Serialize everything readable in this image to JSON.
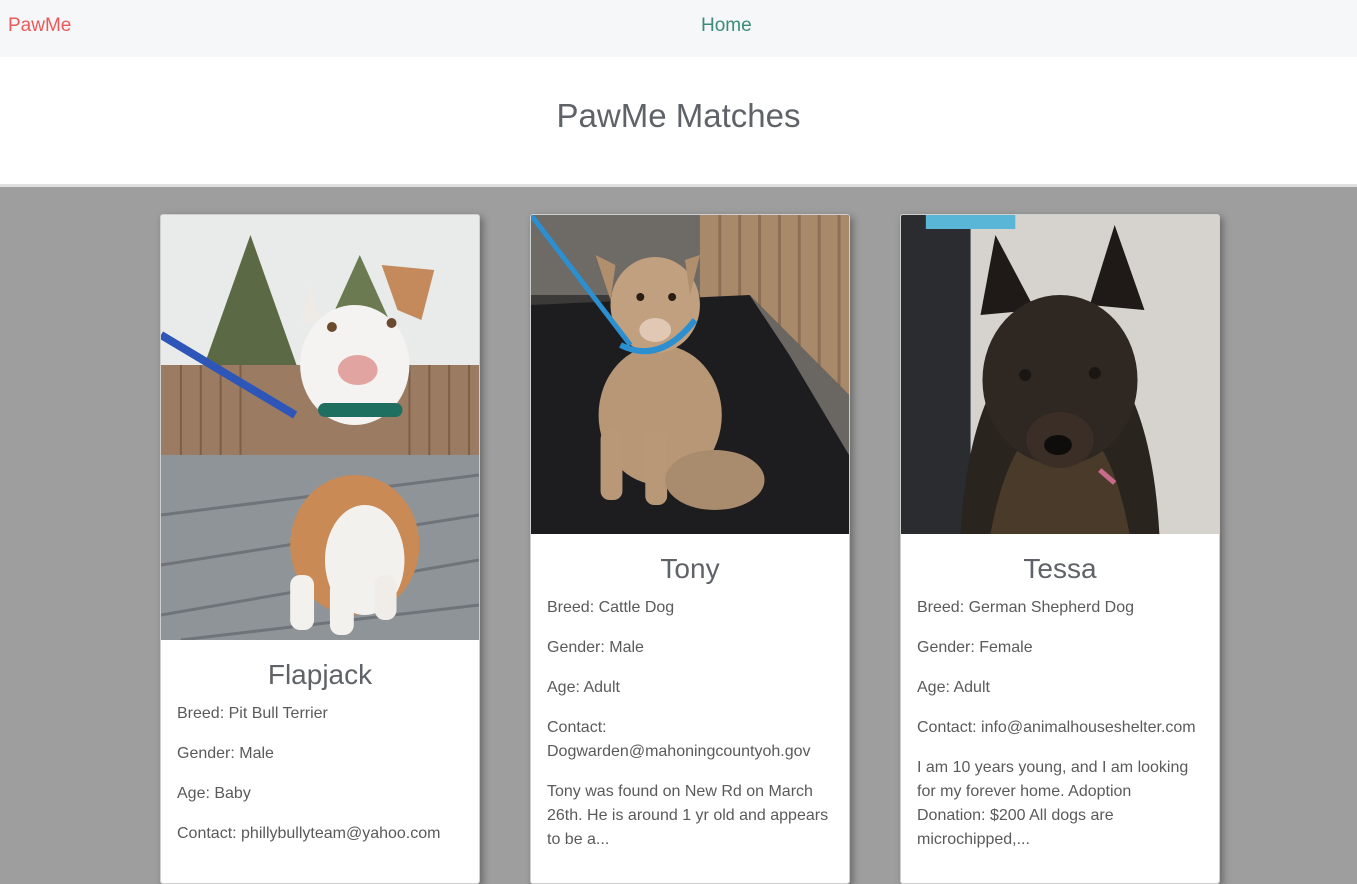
{
  "navbar": {
    "brand": "PawMe",
    "home": "Home"
  },
  "header": {
    "title": "PawMe Matches"
  },
  "cards": [
    {
      "name": "Flapjack",
      "breed": "Breed: Pit Bull Terrier",
      "gender": "Gender: Male",
      "age": "Age: Baby",
      "contact": "Contact: phillybullyteam@yahoo.com",
      "photo_icon": "puppy-photo"
    },
    {
      "name": "Tony",
      "breed": "Breed: Cattle Dog",
      "gender": "Gender: Male",
      "age": "Age: Adult",
      "contact": "Contact: Dogwarden@mahoningcountyoh.gov",
      "description": "Tony was found on New Rd on March 26th. He is around 1 yr old and appears to be a...",
      "photo_icon": "cattle-dog-photo"
    },
    {
      "name": "Tessa",
      "breed": "Breed: German Shepherd Dog",
      "gender": "Gender: Female",
      "age": "Age: Adult",
      "contact": "Contact: info@animalhouseshelter.com",
      "description": "I am 10 years young, and I am looking for my forever home. Adoption Donation: $200 All dogs are microchipped,...",
      "photo_icon": "shepherd-dog-photo"
    }
  ],
  "colors": {
    "brand": "#ea5a5a",
    "nav_link": "#3c8c78",
    "page_bg": "#9e9e9e"
  }
}
